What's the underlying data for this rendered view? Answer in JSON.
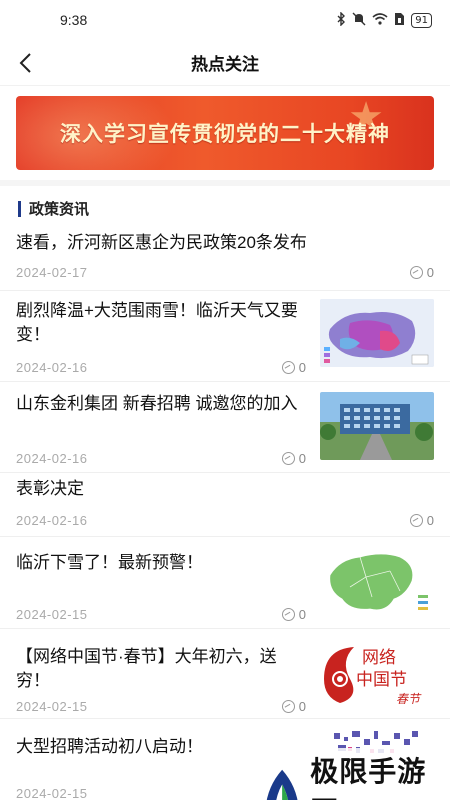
{
  "status": {
    "time": "9:38",
    "battery": "91"
  },
  "nav": {
    "title": "热点关注"
  },
  "banner": {
    "text": "深入学习宣传贯彻党的二十大精神"
  },
  "section": {
    "title": "政策资讯"
  },
  "news": [
    {
      "title": "速看，沂河新区惠企为民政策20条发布",
      "date": "2024-02-17",
      "views": "0",
      "thumb": ""
    },
    {
      "title": "剧烈降温+大范围雨雪！临沂天气又要变！",
      "date": "2024-02-16",
      "views": "0",
      "thumb": "weather-map"
    },
    {
      "title": "山东金利集团 新春招聘 诚邀您的加入",
      "date": "2024-02-16",
      "views": "0",
      "thumb": "office-building"
    },
    {
      "title": "表彰决定",
      "date": "2024-02-16",
      "views": "0",
      "thumb": ""
    },
    {
      "title": "临沂下雪了！最新预警！",
      "date": "2024-02-15",
      "views": "0",
      "thumb": "green-map"
    },
    {
      "title": "【网络中国节·春节】大年初六，送穷！",
      "date": "2024-02-15",
      "views": "0",
      "thumb": "spring-festival-logo"
    },
    {
      "title": "大型招聘活动初八启动！",
      "date": "2024-02-15",
      "views": "",
      "thumb": "qr-pattern"
    }
  ],
  "thumb_texts": {
    "festival_line1": "网络",
    "festival_line2": "中国节",
    "festival_line3": "春节"
  },
  "watermark": {
    "text": "极限手游网"
  },
  "colors": {
    "banner": "#e43a26",
    "section_bar": "#1f3a8a",
    "date": "#aaaaaa"
  }
}
